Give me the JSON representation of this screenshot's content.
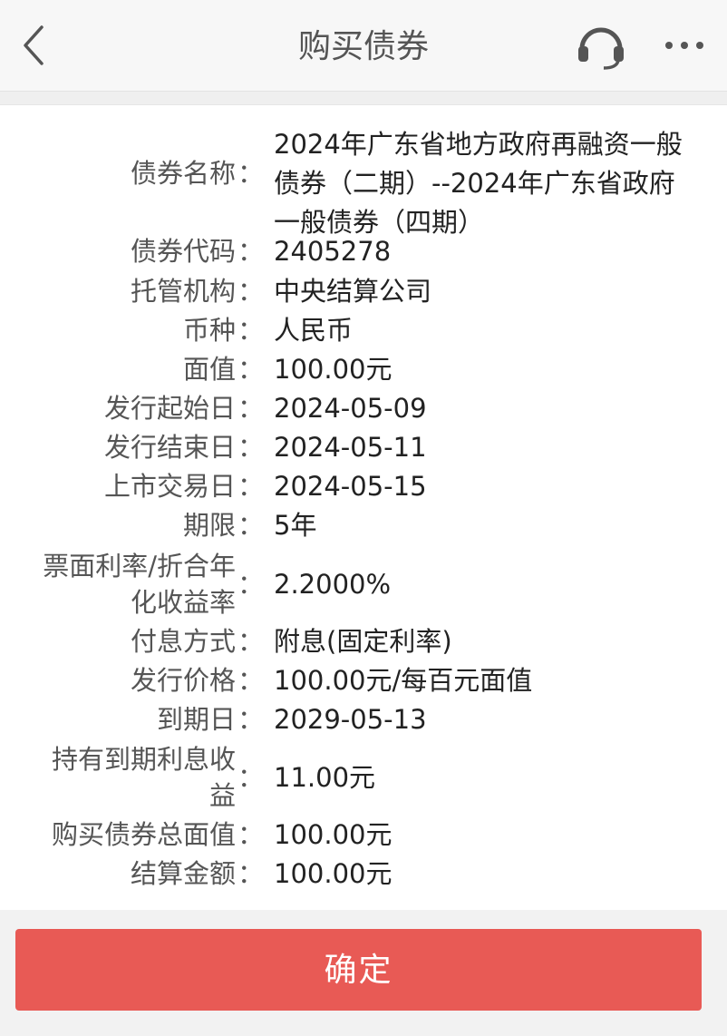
{
  "header": {
    "title": "购买债券"
  },
  "details": {
    "bond_name": {
      "label": "债券名称",
      "colon": "：",
      "value": "2024年广东省地方政府再融资一般债券（二期）--2024年广东省政府一般债券（四期）"
    },
    "bond_code": {
      "label": "债券代码",
      "colon": "：",
      "value": "2405278"
    },
    "custodian": {
      "label": "托管机构",
      "colon": "：",
      "value": "中央结算公司"
    },
    "currency": {
      "label": "币种",
      "colon": "：",
      "value": "人民币"
    },
    "face_value": {
      "label": "面值",
      "colon": "：",
      "value": "100.00元"
    },
    "issue_start": {
      "label": "发行起始日",
      "colon": "：",
      "value": "2024-05-09"
    },
    "issue_end": {
      "label": "发行结束日",
      "colon": "：",
      "value": "2024-05-11"
    },
    "listing_date": {
      "label": "上市交易日",
      "colon": "：",
      "value": "2024-05-15"
    },
    "term": {
      "label": "期限",
      "colon": "：",
      "value": "5年"
    },
    "coupon_rate": {
      "label_line1": "票面利率/折合年",
      "label_line2": "化收益率",
      "colon": "：",
      "value": "2.2000%"
    },
    "interest_method": {
      "label": "付息方式",
      "colon": "：",
      "value": "附息(固定利率)"
    },
    "issue_price": {
      "label": "发行价格",
      "colon": "：",
      "value": "100.00元/每百元面值"
    },
    "maturity_date": {
      "label": "到期日",
      "colon": "：",
      "value": "2029-05-13"
    },
    "hold_to_maturity_interest": {
      "label_line1": "持有到期利息收",
      "label_line2": "益",
      "colon": "：",
      "value": "11.00元"
    },
    "total_face_value": {
      "label": "购买债券总面值",
      "colon": "：",
      "value": "100.00元"
    },
    "settlement_amount": {
      "label": "结算金额",
      "colon": "：",
      "value": "100.00元"
    }
  },
  "footer": {
    "confirm_label": "确定"
  },
  "icons": {
    "back": "back-arrow-icon",
    "service": "headset-icon",
    "more": "more-icon"
  },
  "colors": {
    "accent": "#e85a55",
    "icon": "#555555"
  }
}
